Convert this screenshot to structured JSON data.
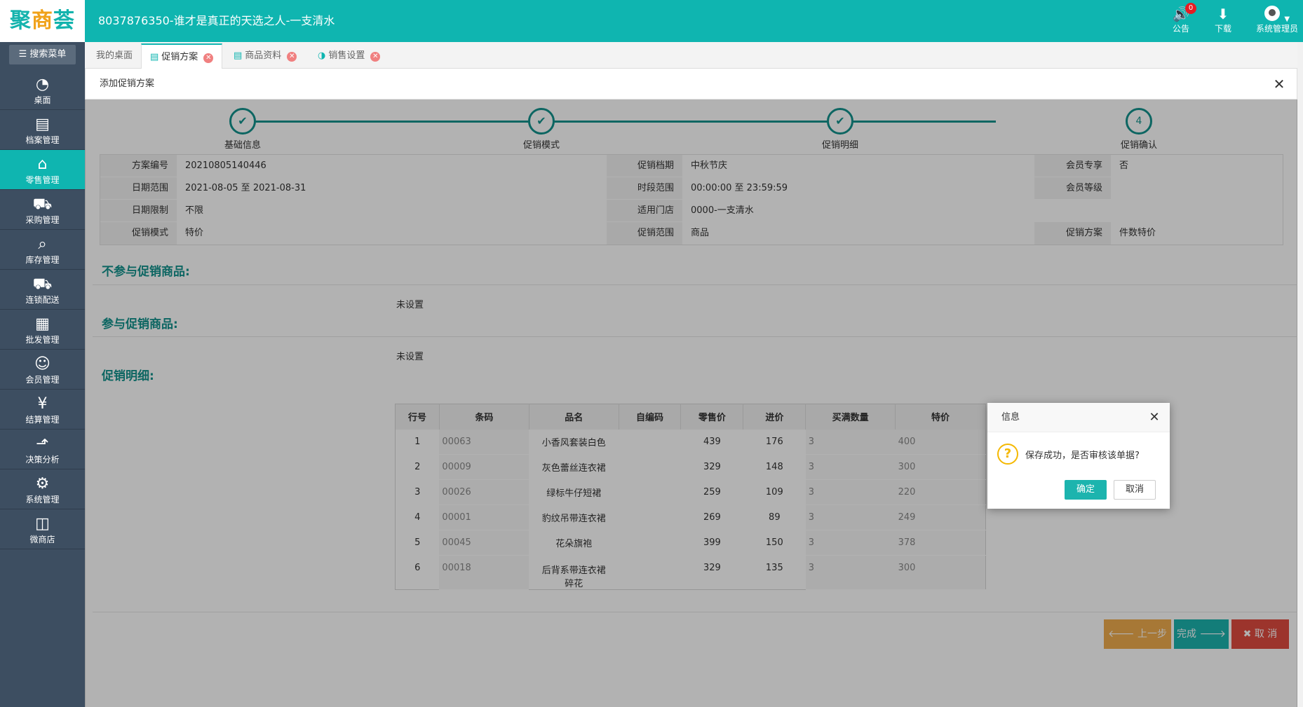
{
  "header": {
    "logo": "聚商荟",
    "logo_accent": "商",
    "title": "8037876350-谁才是真正的天选之人-一支清水",
    "notice_label": "公告",
    "notice_count": "0",
    "download_label": "下载",
    "user_label": "系统管理员"
  },
  "sidebar": {
    "search": "搜索菜单",
    "items": [
      {
        "label": "桌面",
        "icon": "dashboard-icon"
      },
      {
        "label": "档案管理",
        "icon": "file-icon"
      },
      {
        "label": "零售管理",
        "icon": "store-icon"
      },
      {
        "label": "采购管理",
        "icon": "cart-icon"
      },
      {
        "label": "库存管理",
        "icon": "inventory-icon"
      },
      {
        "label": "连锁配送",
        "icon": "truck-icon"
      },
      {
        "label": "批发管理",
        "icon": "wholesale-icon"
      },
      {
        "label": "会员管理",
        "icon": "member-icon"
      },
      {
        "label": "结算管理",
        "icon": "settlement-icon"
      },
      {
        "label": "决策分析",
        "icon": "chart-icon"
      },
      {
        "label": "系统管理",
        "icon": "gear-icon"
      },
      {
        "label": "微商店",
        "icon": "bag-icon"
      }
    ],
    "active_index": 2
  },
  "tabs": [
    {
      "label": "我的桌面"
    },
    {
      "label": "促销方案"
    },
    {
      "label": "商品资料"
    },
    {
      "label": "销售设置"
    }
  ],
  "panel": {
    "title": "添加促销方案",
    "steps": [
      {
        "label": "基础信息",
        "mark": "✔"
      },
      {
        "label": "促销模式",
        "mark": "✔"
      },
      {
        "label": "促销明细",
        "mark": "✔"
      },
      {
        "label": "促销确认",
        "mark": "4"
      }
    ],
    "info": {
      "plan_no_label": "方案编号",
      "plan_no": "20210805140446",
      "period_label": "促销档期",
      "period": "中秋节庆",
      "member_only_label": "会员专享",
      "member_only": "否",
      "date_range_label": "日期范围",
      "date_range": "2021-08-05 至 2021-08-31",
      "time_range_label": "时段范围",
      "time_range": "00:00:00 至 23:59:59",
      "member_level_label": "会员等级",
      "member_level": "",
      "date_limit_label": "日期限制",
      "date_limit": "不限",
      "store_label": "适用门店",
      "store": "0000-一支清水",
      "mode_label": "促销模式",
      "mode": "特价",
      "scope_label": "促销范围",
      "scope": "商品",
      "scheme_label": "促销方案",
      "scheme": "件数特价"
    },
    "excluded_title": "不参与促销商品:",
    "excluded_value": "未设置",
    "included_title": "参与促销商品:",
    "included_value": "未设置",
    "detail_title": "促销明细:",
    "table": {
      "headers": [
        "行号",
        "条码",
        "品名",
        "自编码",
        "零售价",
        "进价",
        "买满数量",
        "特价"
      ],
      "rows": [
        {
          "no": "1",
          "barcode": "00063",
          "name": "小香风套装白色",
          "name2": "",
          "code": "",
          "retail": "439",
          "cost": "176",
          "qty": "3",
          "price": "400"
        },
        {
          "no": "2",
          "barcode": "00009",
          "name": "灰色蕾丝连衣裙",
          "name2": "",
          "code": "",
          "retail": "329",
          "cost": "148",
          "qty": "3",
          "price": "300"
        },
        {
          "no": "3",
          "barcode": "00026",
          "name": "绿标牛仔短裙",
          "name2": "",
          "code": "",
          "retail": "259",
          "cost": "109",
          "qty": "3",
          "price": "220"
        },
        {
          "no": "4",
          "barcode": "00001",
          "name": "豹纹吊带连衣裙",
          "name2": "",
          "code": "",
          "retail": "269",
          "cost": "89",
          "qty": "3",
          "price": "249"
        },
        {
          "no": "5",
          "barcode": "00045",
          "name": "花朵旗袍",
          "name2": "",
          "code": "",
          "retail": "399",
          "cost": "150",
          "qty": "3",
          "price": "378"
        },
        {
          "no": "6",
          "barcode": "00018",
          "name": "后背系带连衣裙",
          "name2": "碎花",
          "code": "",
          "retail": "329",
          "cost": "135",
          "qty": "3",
          "price": "300"
        }
      ]
    },
    "buttons": {
      "prev": "上一步",
      "done": "完成",
      "cancel": "取 消"
    }
  },
  "dialog": {
    "title": "信息",
    "message": "保存成功，是否审核该单据?",
    "ok": "确定",
    "cancel": "取消"
  },
  "colors": {
    "brand": "#0fb5b0",
    "sidebar": "#3d4e61",
    "step": "#13928d",
    "warn": "#f0ad4e",
    "danger": "#e04b3f"
  }
}
